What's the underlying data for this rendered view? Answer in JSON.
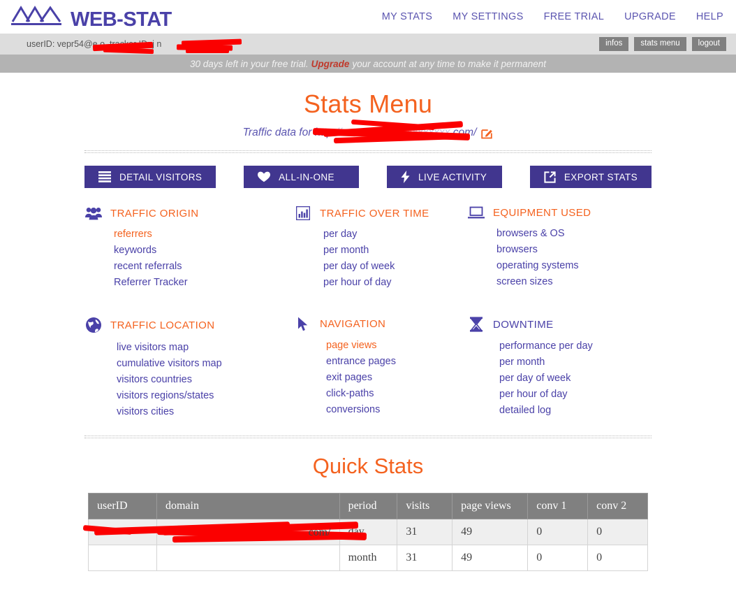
{
  "brand": {
    "name": "WEB-STAT",
    "logo_icon": "mountains-logo",
    "color": "#4a41a8"
  },
  "mainnav": [
    {
      "label": "MY STATS"
    },
    {
      "label": "MY SETTINGS"
    },
    {
      "label": "FREE TRIAL"
    },
    {
      "label": "UPGRADE"
    },
    {
      "label": "HELP"
    }
  ],
  "userbar": {
    "text": "userID: vepr54@e           o, tracker ID: j            n",
    "buttons": [
      {
        "label": "infos",
        "name": "infos-button"
      },
      {
        "label": "stats menu",
        "name": "stats-menu-button"
      },
      {
        "label": "logout",
        "name": "logout-button"
      }
    ]
  },
  "trial_banner": {
    "before": "30 days left in your free trial.",
    "link": "Upgrade",
    "after": "your account at any time to make it permanent",
    "link_color": "#c0392b"
  },
  "page": {
    "title": "Stats Menu",
    "title_color": "#f4621f",
    "subtitle_prefix": "Traffic data for http",
    "subtitle_suffix": "com/",
    "edit_icon": "edit-pencil-square-icon"
  },
  "quick_buttons": [
    {
      "label": "DETAIL VISITORS",
      "icon": "list-lines-icon",
      "name": "detail-visitors-button"
    },
    {
      "label": "ALL-IN-ONE",
      "icon": "heart-icon",
      "name": "all-in-one-button"
    },
    {
      "label": "LIVE ACTIVITY",
      "icon": "lightning-bolt-icon",
      "name": "live-activity-button"
    },
    {
      "label": "EXPORT STATS",
      "icon": "external-link-icon",
      "name": "export-stats-button"
    }
  ],
  "categories": [
    {
      "title": "TRAFFIC ORIGIN",
      "icon": "people-group-icon",
      "title_color": "#f4621f",
      "items": [
        {
          "label": "referrers",
          "active": true
        },
        {
          "label": "keywords",
          "active": false
        },
        {
          "label": "recent referrals",
          "active": false
        },
        {
          "label": "Referrer Tracker",
          "active": false
        }
      ]
    },
    {
      "title": "TRAFFIC OVER TIME",
      "icon": "bar-chart-icon",
      "title_color": "#f4621f",
      "items": [
        {
          "label": "per day",
          "active": false
        },
        {
          "label": "per month",
          "active": false
        },
        {
          "label": "per day of week",
          "active": false
        },
        {
          "label": "per hour of day",
          "active": false
        }
      ]
    },
    {
      "title": "EQUIPMENT USED",
      "icon": "laptop-icon",
      "title_color": "#f4621f",
      "items": [
        {
          "label": "browsers & OS",
          "active": false
        },
        {
          "label": "browsers",
          "active": false
        },
        {
          "label": "operating systems",
          "active": false
        },
        {
          "label": "screen sizes",
          "active": false
        }
      ]
    },
    {
      "title": "TRAFFIC LOCATION",
      "icon": "globe-icon",
      "title_color": "#f4621f",
      "items": [
        {
          "label": "live visitors map",
          "active": false
        },
        {
          "label": "cumulative visitors map",
          "active": false
        },
        {
          "label": "visitors countries",
          "active": false
        },
        {
          "label": "visitors regions/states",
          "active": false
        },
        {
          "label": "visitors cities",
          "active": false
        }
      ]
    },
    {
      "title": "NAVIGATION",
      "icon": "cursor-arrow-icon",
      "title_color": "#f4621f",
      "items": [
        {
          "label": "page views",
          "active": true
        },
        {
          "label": "entrance pages",
          "active": false
        },
        {
          "label": "exit pages",
          "active": false
        },
        {
          "label": "click-paths",
          "active": false
        },
        {
          "label": "conversions",
          "active": false
        }
      ]
    },
    {
      "title": "DOWNTIME",
      "icon": "hourglass-icon",
      "title_color": "#4a41a8",
      "items": [
        {
          "label": "performance per day",
          "active": false
        },
        {
          "label": "per month",
          "active": false
        },
        {
          "label": "per day of week",
          "active": false
        },
        {
          "label": "per hour of day",
          "active": false
        },
        {
          "label": "detailed log",
          "active": false
        }
      ]
    }
  ],
  "quick_stats": {
    "title": "Quick Stats",
    "columns": [
      "userID",
      "domain",
      "period",
      "visits",
      "page views",
      "conv 1",
      "conv 2"
    ],
    "rows": [
      {
        "userID": "",
        "domain": "com/",
        "period": "day",
        "visits": "31",
        "page_views": "49",
        "conv1": "0",
        "conv2": "0"
      },
      {
        "userID": "",
        "domain": "",
        "period": "month",
        "visits": "31",
        "page_views": "49",
        "conv1": "0",
        "conv2": "0"
      }
    ]
  }
}
